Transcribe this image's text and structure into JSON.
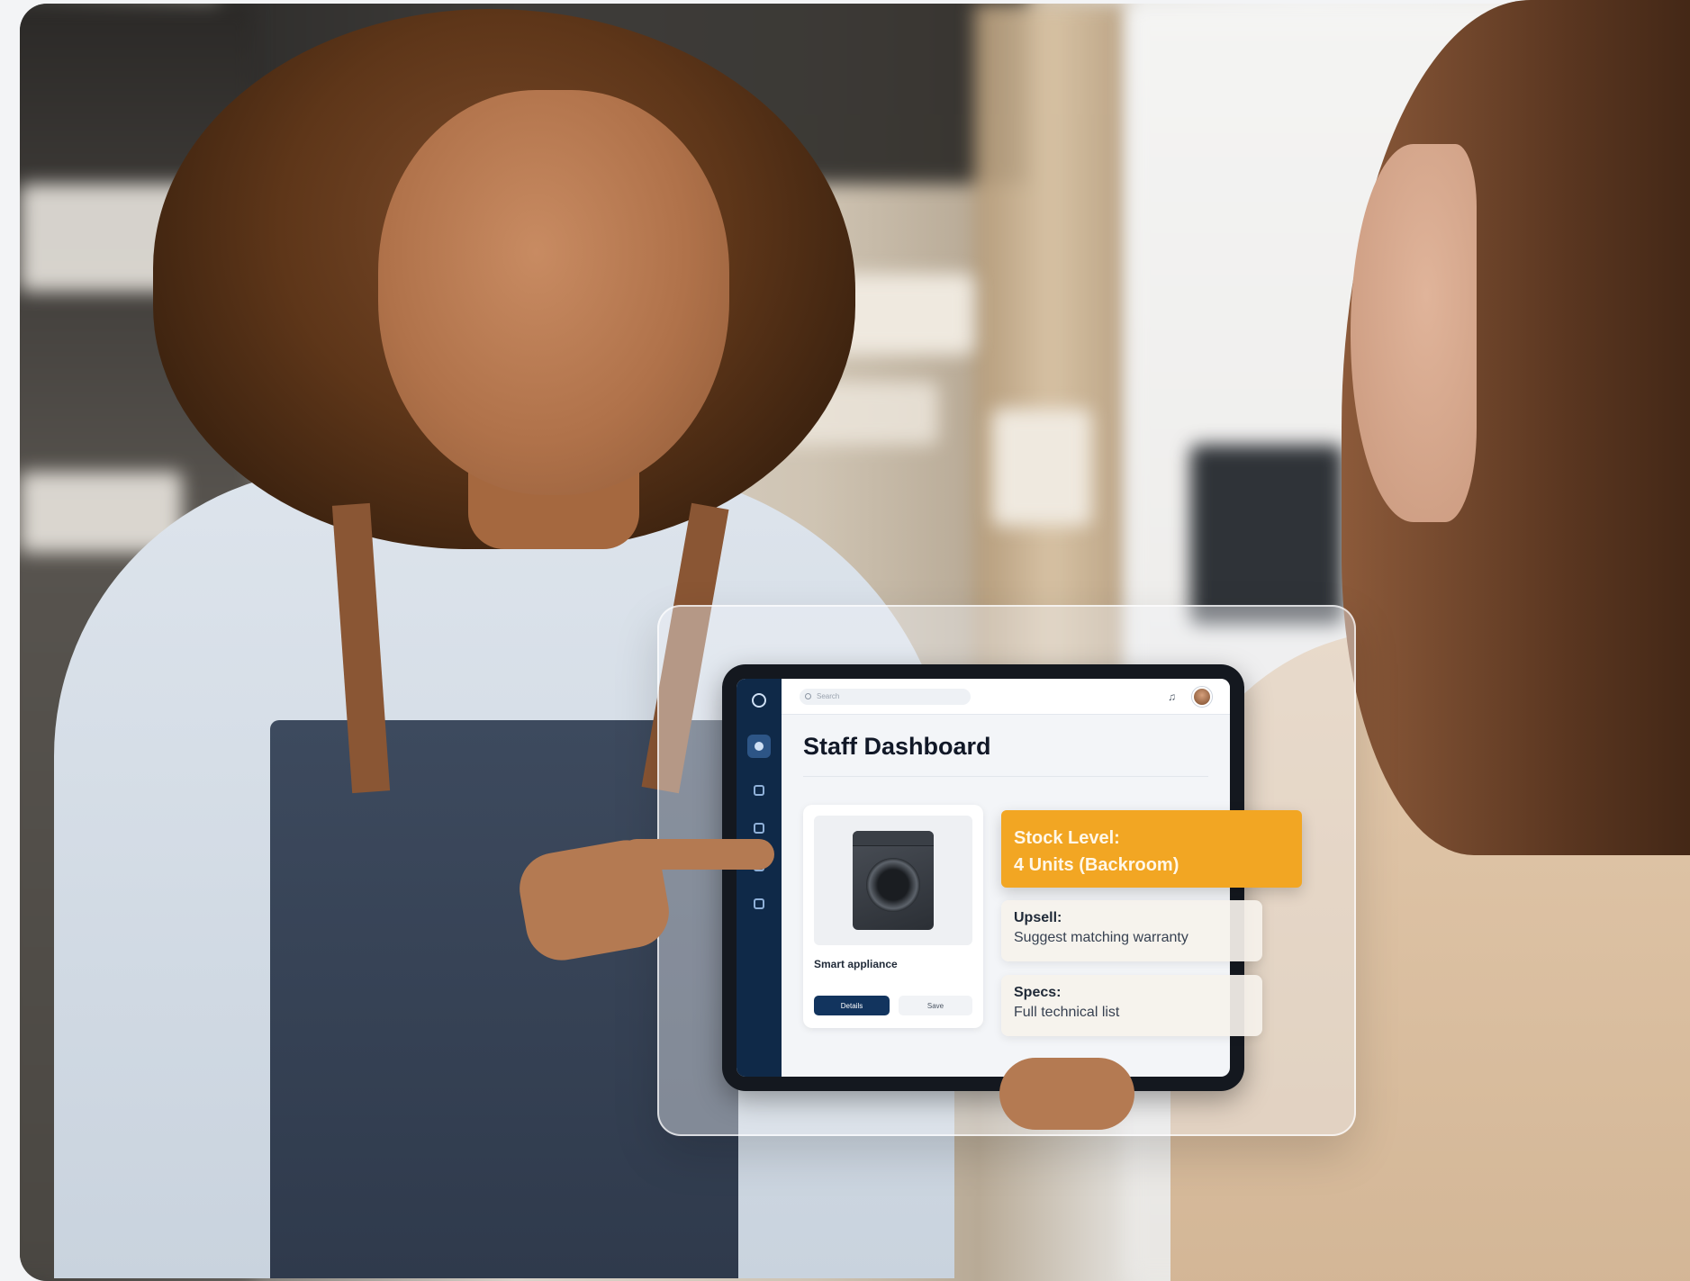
{
  "dashboard": {
    "title": "Staff Dashboard",
    "search_placeholder": "Search"
  },
  "product_card": {
    "name": "Smart appliance",
    "primary_button": "Details",
    "secondary_button": "Save"
  },
  "notices": {
    "stock_line1": "Stock Level:",
    "stock_line2": "4 Units (Backroom)",
    "upsell_heading": "Upsell:",
    "upsell_text": "Suggest matching warranty",
    "specs_heading": "Specs:",
    "specs_text": "Full technical list"
  },
  "colors": {
    "accent_orange": "#f2a623",
    "navy": "#12345e",
    "sidebar": "#0f2948"
  },
  "icons": [
    "logo-icon",
    "chat-icon",
    "box-icon",
    "tag-icon",
    "chart-icon",
    "settings-icon",
    "search-icon",
    "bell-icon"
  ]
}
